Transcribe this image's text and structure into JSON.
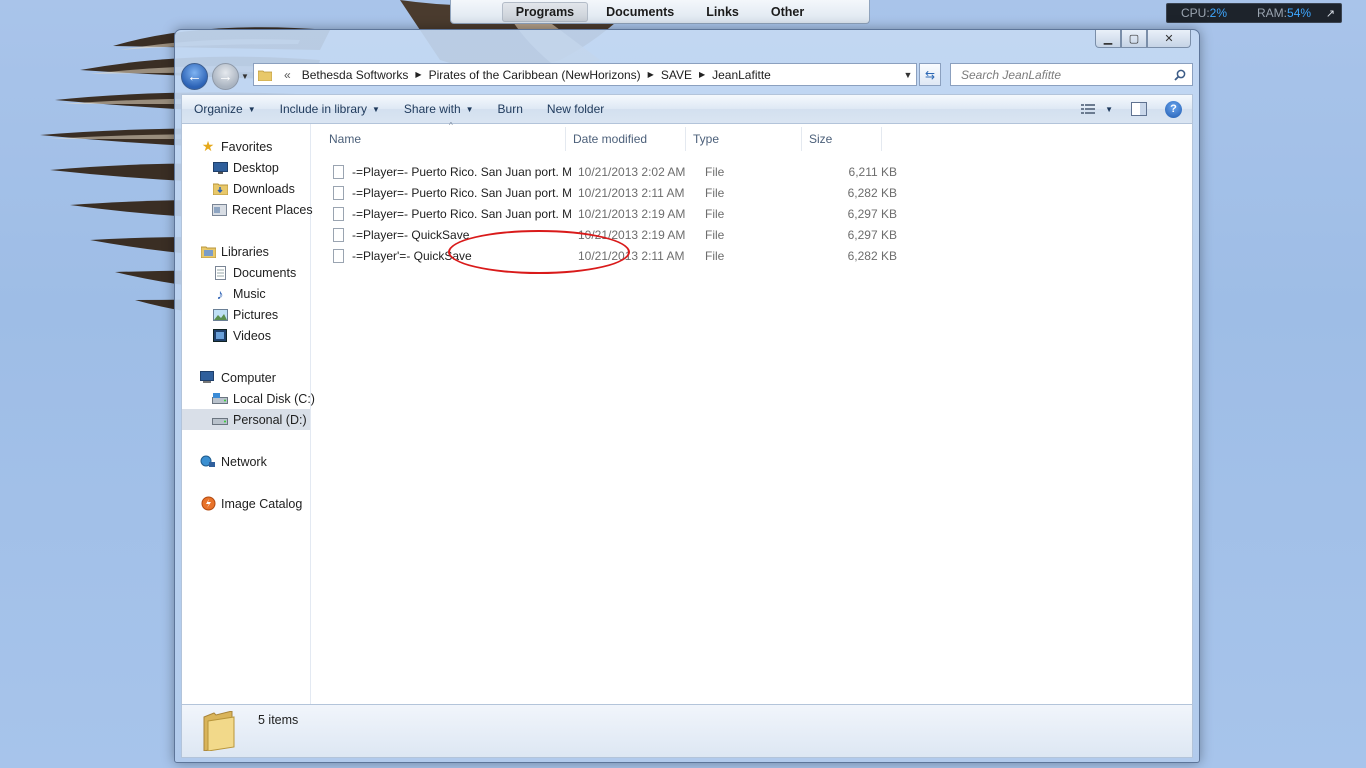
{
  "dock": {
    "tabs": [
      {
        "label": "Programs",
        "active": true
      },
      {
        "label": "Documents",
        "active": false
      },
      {
        "label": "Links",
        "active": false
      },
      {
        "label": "Other",
        "active": false
      }
    ]
  },
  "meter": {
    "cpu_label": "CPU:",
    "cpu_value": "2%",
    "ram_label": "RAM:",
    "ram_value": "54%",
    "arrow": "↗"
  },
  "address": {
    "chevron": "«",
    "crumbs": [
      "Bethesda Softworks",
      "Pirates of the Caribbean (NewHorizons)",
      "SAVE",
      "JeanLafitte"
    ]
  },
  "search": {
    "placeholder": "Search JeanLafitte"
  },
  "toolbar": {
    "organize": "Organize",
    "include_in_library": "Include in library",
    "share_with": "Share with",
    "burn": "Burn",
    "new_folder": "New folder"
  },
  "navpane": {
    "favorites": "Favorites",
    "desktop": "Desktop",
    "downloads": "Downloads",
    "recent_places": "Recent Places",
    "libraries": "Libraries",
    "documents": "Documents",
    "music": "Music",
    "pictures": "Pictures",
    "videos": "Videos",
    "computer": "Computer",
    "local_disk": "Local Disk (C:)",
    "personal": "Personal (D:)",
    "network": "Network",
    "image_catalog": "Image Catalog"
  },
  "columns": {
    "name": "Name",
    "date": "Date modified",
    "type": "Type",
    "size": "Size"
  },
  "files": [
    {
      "name": "-=Player=- Puerto Rico. San Juan port. M...",
      "date": "10/21/2013 2:02 AM",
      "type": "File",
      "size": "6,211 KB"
    },
    {
      "name": "-=Player=- Puerto Rico. San Juan port. M...",
      "date": "10/21/2013 2:11 AM",
      "type": "File",
      "size": "6,282 KB"
    },
    {
      "name": "-=Player=- Puerto Rico. San Juan port. M...",
      "date": "10/21/2013 2:19 AM",
      "type": "File",
      "size": "6,297 KB"
    },
    {
      "name": "-=Player=- QuickSave",
      "date": "10/21/2013 2:19 AM",
      "type": "File",
      "size": "6,297 KB"
    },
    {
      "name": "-=Player'=- QuickSave",
      "date": "10/21/2013 2:11 AM",
      "type": "File",
      "size": "6,282 KB"
    }
  ],
  "details": {
    "count": "5 items"
  },
  "colors": {
    "annotation": "#d91a1a",
    "accent": "#2c62b5"
  }
}
